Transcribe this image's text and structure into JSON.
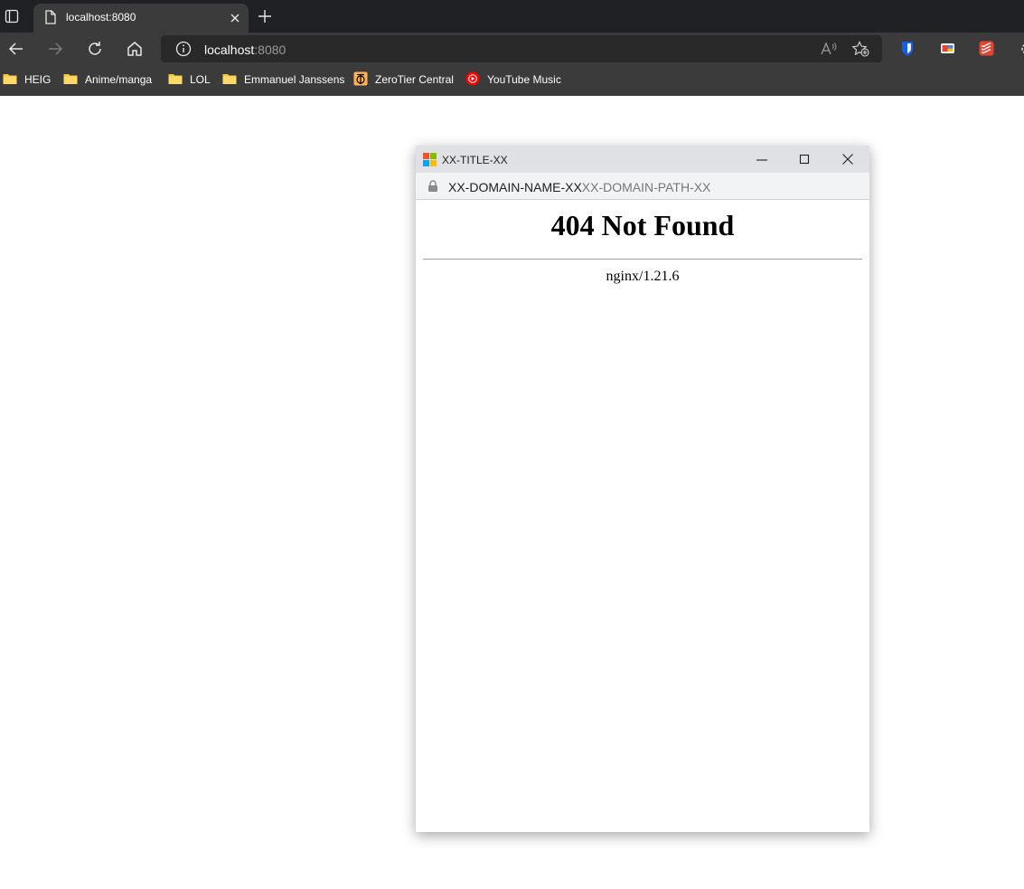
{
  "browser": {
    "tab": {
      "title": "localhost:8080"
    },
    "address": {
      "host": "localhost",
      "port": ":8080"
    },
    "bookmarks": [
      {
        "label": "HEIG",
        "icon": "folder-icon"
      },
      {
        "label": "Anime/manga",
        "icon": "folder-icon"
      },
      {
        "label": "LOL",
        "icon": "folder-icon"
      },
      {
        "label": "Emmanuel Janssens",
        "icon": "folder-icon"
      },
      {
        "label": "ZeroTier Central",
        "icon": "zerotier-icon"
      },
      {
        "label": "YouTube Music",
        "icon": "youtube-music-icon"
      }
    ],
    "colors": {
      "chrome_dark": "#202124",
      "chrome": "#3b3b3b",
      "folder": "#f5c842"
    }
  },
  "popup": {
    "title": "XX-TITLE-XX",
    "domain": "XX-DOMAIN-NAME-XX",
    "path": "XX-DOMAIN-PATH-XX"
  },
  "page": {
    "heading": "404 Not Found",
    "server": "nginx/1.21.6"
  }
}
